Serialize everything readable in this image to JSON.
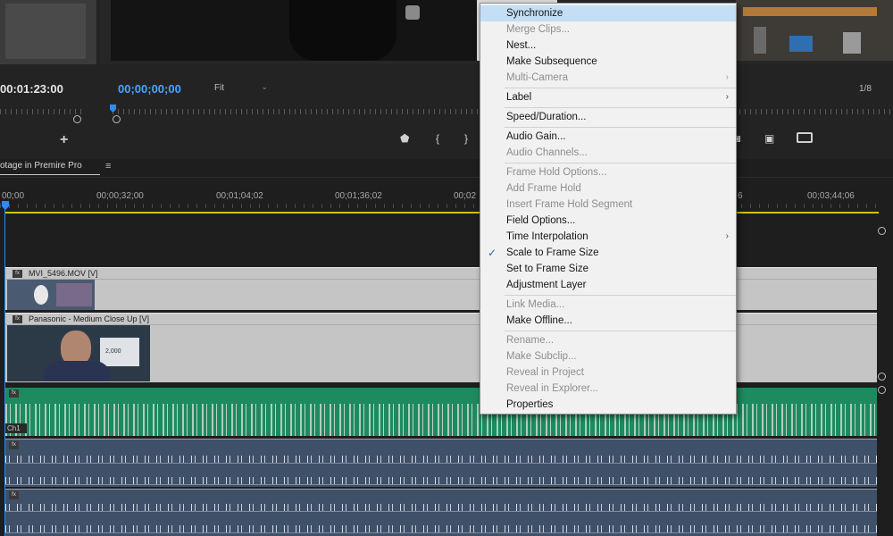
{
  "source_monitor": {
    "timecode": "00:01:23:00"
  },
  "program_monitor": {
    "timecode": "00;00;00;00",
    "zoom": "Fit",
    "resolution": "1/8"
  },
  "controls": {
    "add": "+",
    "marker": "⬟",
    "mark_in": "{",
    "mark_out": "}",
    "camera": "◙",
    "compare": "▣"
  },
  "timeline": {
    "sequence_tab": "otage in Premire Pro",
    "menu_icon": "≡",
    "ruler": [
      "00;00",
      "00;00;32;00",
      "00;01;04;02",
      "00;01;36;02",
      "00;02",
      "6",
      "00;03;44;06"
    ],
    "accent_color": "#2d8ceb",
    "work_area_color": "#d6c000"
  },
  "tracks": {
    "v2_clip_name": "MVI_5496.MOV [V]",
    "v1_clip_name": "Panasonic - Medium Close Up [V]",
    "thumbnail_text": "2,000",
    "audio_channel_label": "Ch1",
    "fx_badge": "fx"
  },
  "context_menu": {
    "items": [
      {
        "label": "Synchronize",
        "state": "highlighted"
      },
      {
        "label": "Merge Clips...",
        "state": "disabled"
      },
      {
        "label": "Nest...",
        "state": "enabled"
      },
      {
        "label": "Make Subsequence",
        "state": "enabled"
      },
      {
        "label": "Multi-Camera",
        "state": "disabled",
        "submenu": true
      },
      {
        "label": "Label",
        "state": "enabled",
        "submenu": true
      },
      {
        "label": "Speed/Duration...",
        "state": "enabled"
      },
      {
        "label": "Audio Gain...",
        "state": "enabled"
      },
      {
        "label": "Audio Channels...",
        "state": "disabled"
      },
      {
        "label": "Frame Hold Options...",
        "state": "disabled"
      },
      {
        "label": "Add Frame Hold",
        "state": "disabled"
      },
      {
        "label": "Insert Frame Hold Segment",
        "state": "disabled"
      },
      {
        "label": "Field Options...",
        "state": "enabled"
      },
      {
        "label": "Time Interpolation",
        "state": "enabled",
        "submenu": true
      },
      {
        "label": "Scale to Frame Size",
        "state": "enabled",
        "checked": true
      },
      {
        "label": "Set to Frame Size",
        "state": "enabled"
      },
      {
        "label": "Adjustment Layer",
        "state": "enabled"
      },
      {
        "label": "Link Media...",
        "state": "disabled"
      },
      {
        "label": "Make Offline...",
        "state": "enabled"
      },
      {
        "label": "Rename...",
        "state": "disabled"
      },
      {
        "label": "Make Subclip...",
        "state": "disabled"
      },
      {
        "label": "Reveal in Project",
        "state": "disabled"
      },
      {
        "label": "Reveal in Explorer...",
        "state": "disabled"
      },
      {
        "label": "Properties",
        "state": "enabled"
      }
    ],
    "submenu_arrow": "›",
    "checkmark": "✓",
    "highlight_color": "#c4def6"
  }
}
